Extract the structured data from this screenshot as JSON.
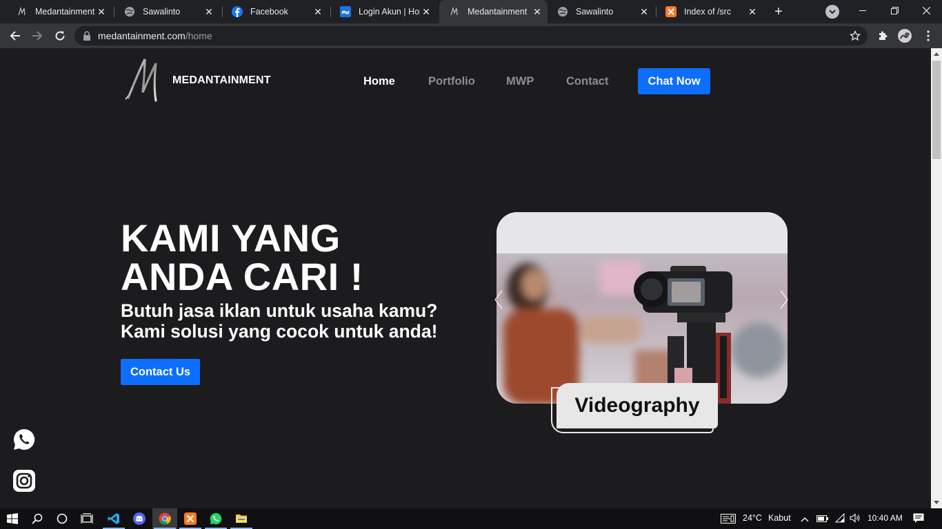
{
  "browser": {
    "tabs": [
      {
        "title": "Medantainment",
        "favicon": "medantainment-favicon",
        "active": false
      },
      {
        "title": "Sawalinto",
        "favicon": "globe-icon",
        "active": false
      },
      {
        "title": "Facebook",
        "favicon": "facebook-icon",
        "active": false
      },
      {
        "title": "Login Akun | Host",
        "favicon": "hostinger-icon",
        "active": false
      },
      {
        "title": "Medantainment",
        "favicon": "medantainment-favicon",
        "active": true
      },
      {
        "title": "Sawalinto",
        "favicon": "globe-icon",
        "active": false
      },
      {
        "title": "Index of /src",
        "favicon": "xampp-icon",
        "active": false
      }
    ],
    "address": {
      "domain": "medantainment.com",
      "path": "/home"
    }
  },
  "site": {
    "brand": "MEDANTAINMENT",
    "nav": [
      "Home",
      "Portfolio",
      "MWP",
      "Contact"
    ],
    "chat_button": "Chat Now",
    "hero": {
      "title_line1": "KAMI YANG",
      "title_line2": "ANDA CARI !",
      "subtitle_line1": "Butuh jasa iklan untuk usaha kamu?",
      "subtitle_line2": "Kami solusi yang cocok untuk anda!",
      "cta": "Contact Us"
    },
    "carousel": {
      "caption": "Videography",
      "prev_icon": "chevron-left-icon",
      "next_icon": "chevron-right-icon"
    },
    "social": [
      "whatsapp-icon",
      "instagram-icon"
    ]
  },
  "taskbar": {
    "apps": [
      "windows-start-icon",
      "search-icon",
      "cortana-icon",
      "task-view-icon",
      "vscode-icon",
      "discord-icon",
      "chrome-icon",
      "xampp-icon",
      "whatsapp-icon",
      "file-explorer-icon"
    ],
    "weather": {
      "temp": "24°C",
      "condition": "Kabut"
    },
    "time": "10:40 AM"
  },
  "colors": {
    "accent": "#0d6efd",
    "page_bg": "#1c1b1d",
    "chrome_bg": "#202124",
    "toolbar_bg": "#35363a"
  }
}
